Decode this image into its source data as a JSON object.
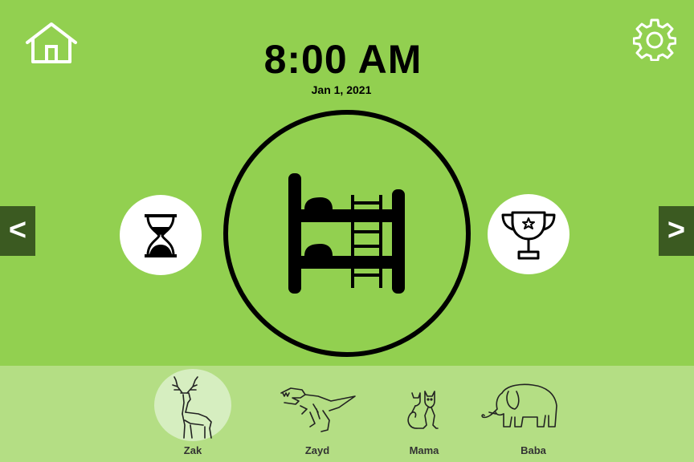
{
  "clock": {
    "time": "8:00 AM",
    "date": "Jan 1, 2021"
  },
  "nav": {
    "prev_label": "<",
    "next_label": ">"
  },
  "icons": {
    "home": "home-icon",
    "settings": "gear-icon",
    "timer": "hourglass-icon",
    "main": "bunk-bed-icon",
    "rewards": "trophy-icon"
  },
  "colors": {
    "background": "#92d050",
    "bottom_bar": "#b4de84",
    "selected_profile": "#d6eec0",
    "nav_arrow": "#3b5a21"
  },
  "profiles": [
    {
      "name": "Zak",
      "icon": "deer-icon",
      "selected": true
    },
    {
      "name": "Zayd",
      "icon": "dinosaur-icon",
      "selected": false
    },
    {
      "name": "Mama",
      "icon": "cat-icon",
      "selected": false
    },
    {
      "name": "Baba",
      "icon": "elephant-icon",
      "selected": false
    }
  ]
}
